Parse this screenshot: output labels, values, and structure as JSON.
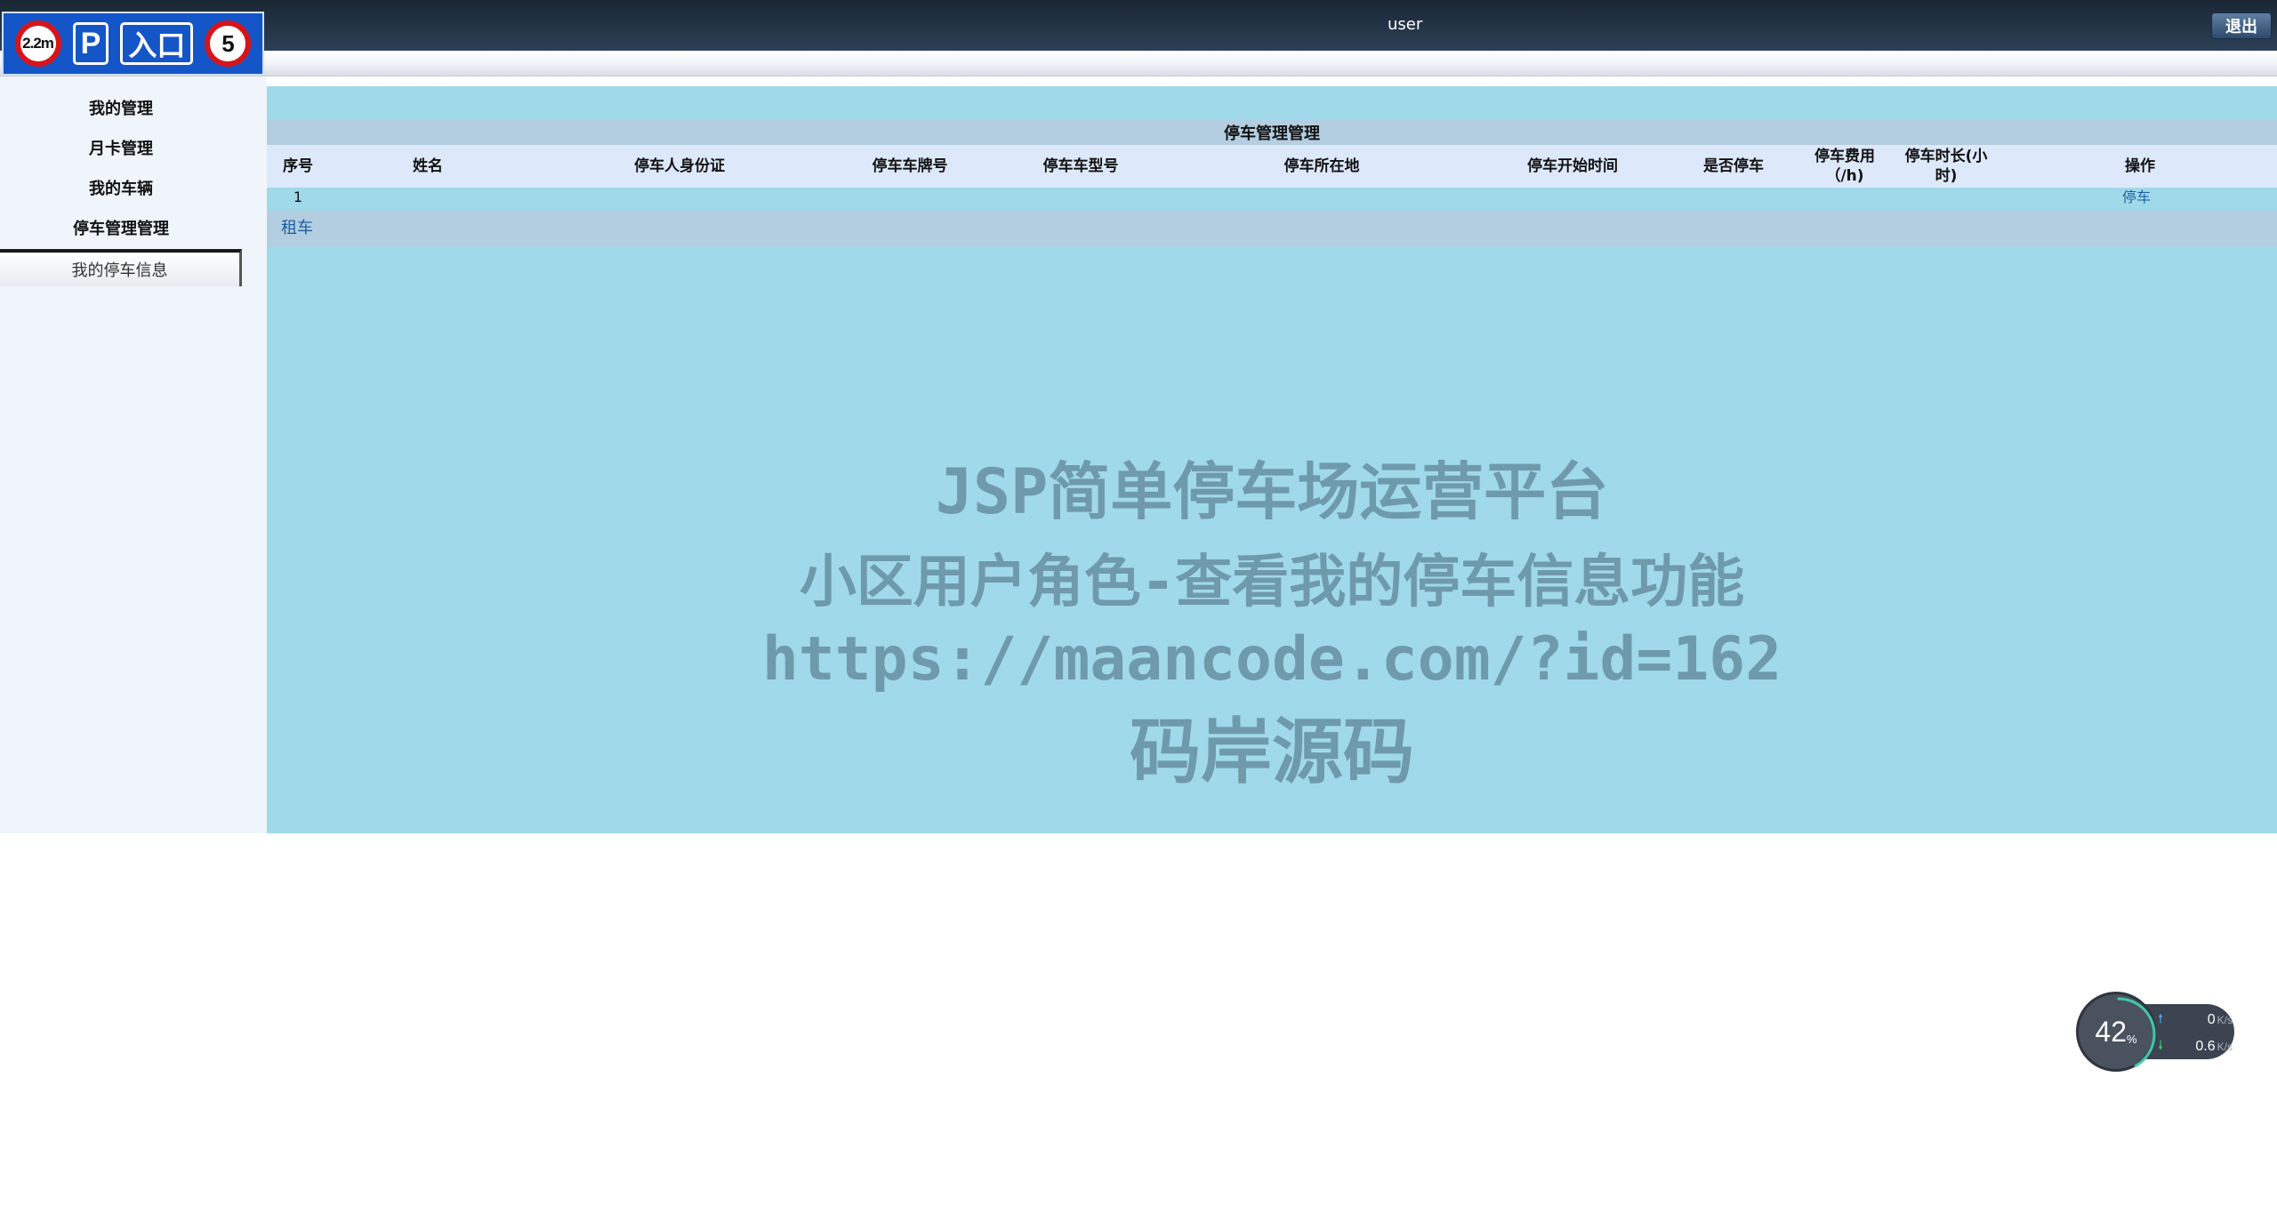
{
  "header": {
    "logo": {
      "height_limit": "2.2m",
      "parking_letter": "P",
      "entrance_text": "入口",
      "speed_limit": "5"
    },
    "user_name": "user",
    "logout_label": "退出"
  },
  "sidebar": {
    "items": [
      {
        "label": "我的管理"
      },
      {
        "label": "月卡管理"
      },
      {
        "label": "我的车辆"
      },
      {
        "label": "停车管理管理"
      }
    ],
    "subitem": {
      "label": "我的停车信息"
    }
  },
  "table": {
    "title": "停车管理管理",
    "columns": [
      "序号",
      "姓名",
      "停车人身份证",
      "停车车牌号",
      "停车车型号",
      "停车所在地",
      "停车开始时间",
      "是否停车",
      "停车费用（/h)",
      "停车时长(小时)",
      "操作"
    ],
    "rows": [
      {
        "index": "1",
        "action": "停车"
      }
    ],
    "footer_link": "租车"
  },
  "watermark": {
    "line1": "JSP简单停车场运营平台",
    "line2": "小区用户角色-查看我的停车信息功能",
    "line3": "https://maancode.com/?id=162",
    "line4": "码岸源码"
  },
  "speed_widget": {
    "cpu_percent": "42",
    "cpu_fraction": 0.42,
    "upload_rate": "0",
    "download_rate": "0.6",
    "unit": "K/s",
    "accent_color": "#3fc9a8"
  },
  "colors": {
    "header_bg": "#223244",
    "sidebar_bg": "#eff5fb",
    "panel_bg": "#a0d9ea",
    "title_row_bg": "#b3cee0",
    "header_row_bg": "#dde9fa",
    "link_color": "#1b5fa4",
    "logo_blue": "#1456c8"
  }
}
